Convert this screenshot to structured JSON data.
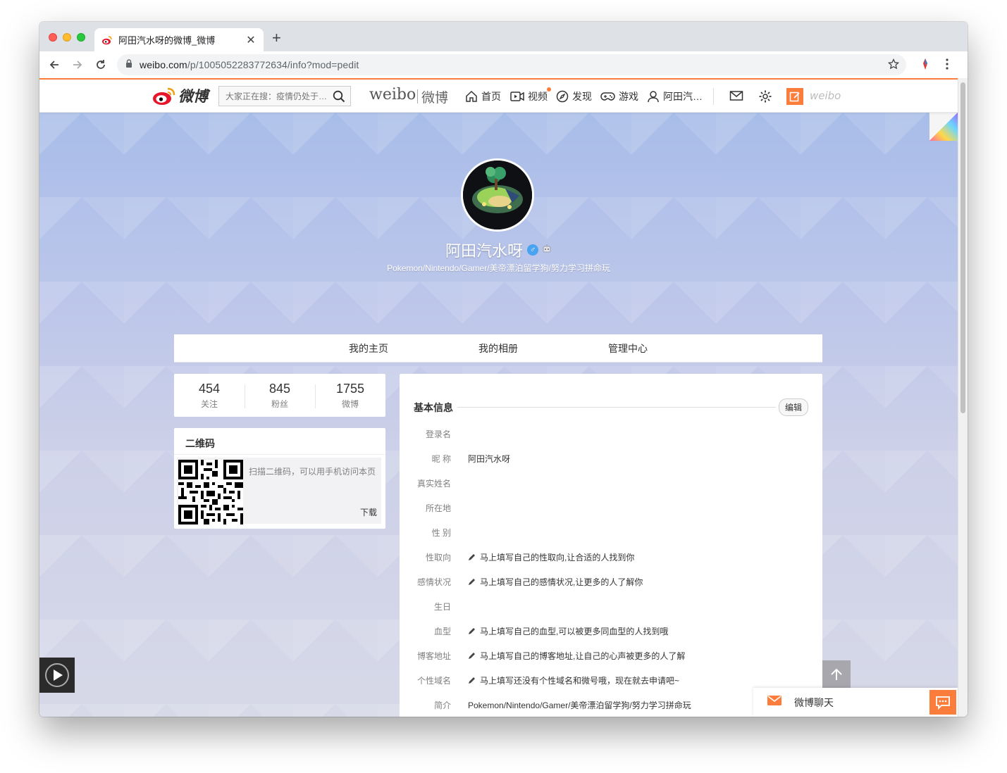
{
  "browser": {
    "tab_title": "阿田汽水呀的微博_微博",
    "url_host": "weibo.com",
    "url_path": "/p/1005052283772634/info?mod=pedit"
  },
  "header": {
    "logo_text": "微博",
    "search_placeholder": "大家正在搜：疫情仍处于…",
    "brand_en": "weibo",
    "brand_cn": "微博",
    "nav": {
      "home": "首页",
      "video": "视频",
      "discover": "发现",
      "games": "游戏",
      "profile": "阿田汽…"
    },
    "weibo_small": "weibo"
  },
  "profile": {
    "username": "阿田汽水呀",
    "gender_symbol": "♂",
    "bio": "Pokemon/Nintendo/Gamer/美帝漂泊留学狗/努力学习拼命玩",
    "tabs": [
      "我的主页",
      "我的相册",
      "管理中心"
    ]
  },
  "stats": [
    {
      "num": "454",
      "label": "关注"
    },
    {
      "num": "845",
      "label": "粉丝"
    },
    {
      "num": "1755",
      "label": "微博"
    }
  ],
  "qr": {
    "title": "二维码",
    "text": "扫描二维码，可以用手机访问本页",
    "download": "下载"
  },
  "info": {
    "title": "基本信息",
    "edit": "编辑",
    "rows": [
      {
        "label": "登录名",
        "value": "",
        "hint": false
      },
      {
        "label": "昵  称",
        "value": "阿田汽水呀",
        "hint": false
      },
      {
        "label": "真实姓名",
        "value": "",
        "hint": false
      },
      {
        "label": "所在地",
        "value": "",
        "hint": false
      },
      {
        "label": "性  别",
        "value": "",
        "hint": false
      },
      {
        "label": "性取向",
        "value": "马上填写自己的性取向,让合适的人找到你",
        "hint": true
      },
      {
        "label": "感情状况",
        "value": "马上填写自己的感情状况,让更多的人了解你",
        "hint": true
      },
      {
        "label": "生日",
        "value": "",
        "hint": false
      },
      {
        "label": "血型",
        "value": "马上填写自己的血型,可以被更多同血型的人找到哦",
        "hint": true
      },
      {
        "label": "博客地址",
        "value": "马上填写自己的博客地址,让自己的心声被更多的人了解",
        "hint": true
      },
      {
        "label": "个性域名",
        "value": "马上填写还没有个性域名和微号哦，现在就去申请吧~",
        "hint": true
      },
      {
        "label": "简介",
        "value": "Pokemon/Nintendo/Gamer/美帝漂泊留学狗/努力学习拼命玩",
        "hint": false
      }
    ]
  },
  "chat": {
    "label": "微博聊天"
  },
  "colors": {
    "accent": "#fa7d3c",
    "gender": "#4aa3f0"
  }
}
